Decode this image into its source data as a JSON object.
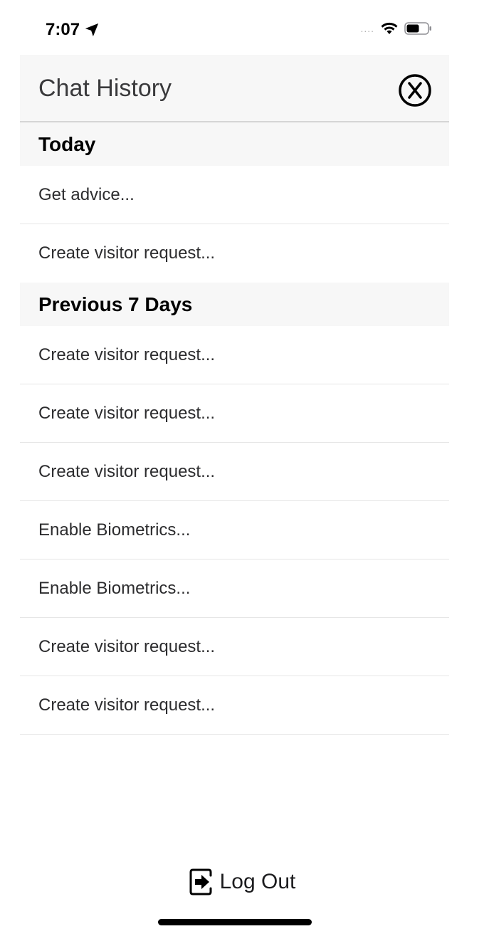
{
  "status_bar": {
    "time": "7:07",
    "signal": "....",
    "location_icon": "location-arrow-icon",
    "wifi_icon": "wifi-icon",
    "battery_icon": "battery-icon"
  },
  "header": {
    "title": "Chat History",
    "close_icon": "close-circle-icon"
  },
  "sections": [
    {
      "title": "Today",
      "items": [
        "Get advice...",
        "Create visitor request..."
      ]
    },
    {
      "title": "Previous 7 Days",
      "items": [
        "Create visitor request...",
        "Create visitor request...",
        "Create visitor request...",
        "Enable Biometrics...",
        "Enable Biometrics...",
        "Create visitor request...",
        "Create visitor request..."
      ]
    }
  ],
  "footer": {
    "logout_label": "Log Out",
    "logout_icon": "logout-icon"
  }
}
